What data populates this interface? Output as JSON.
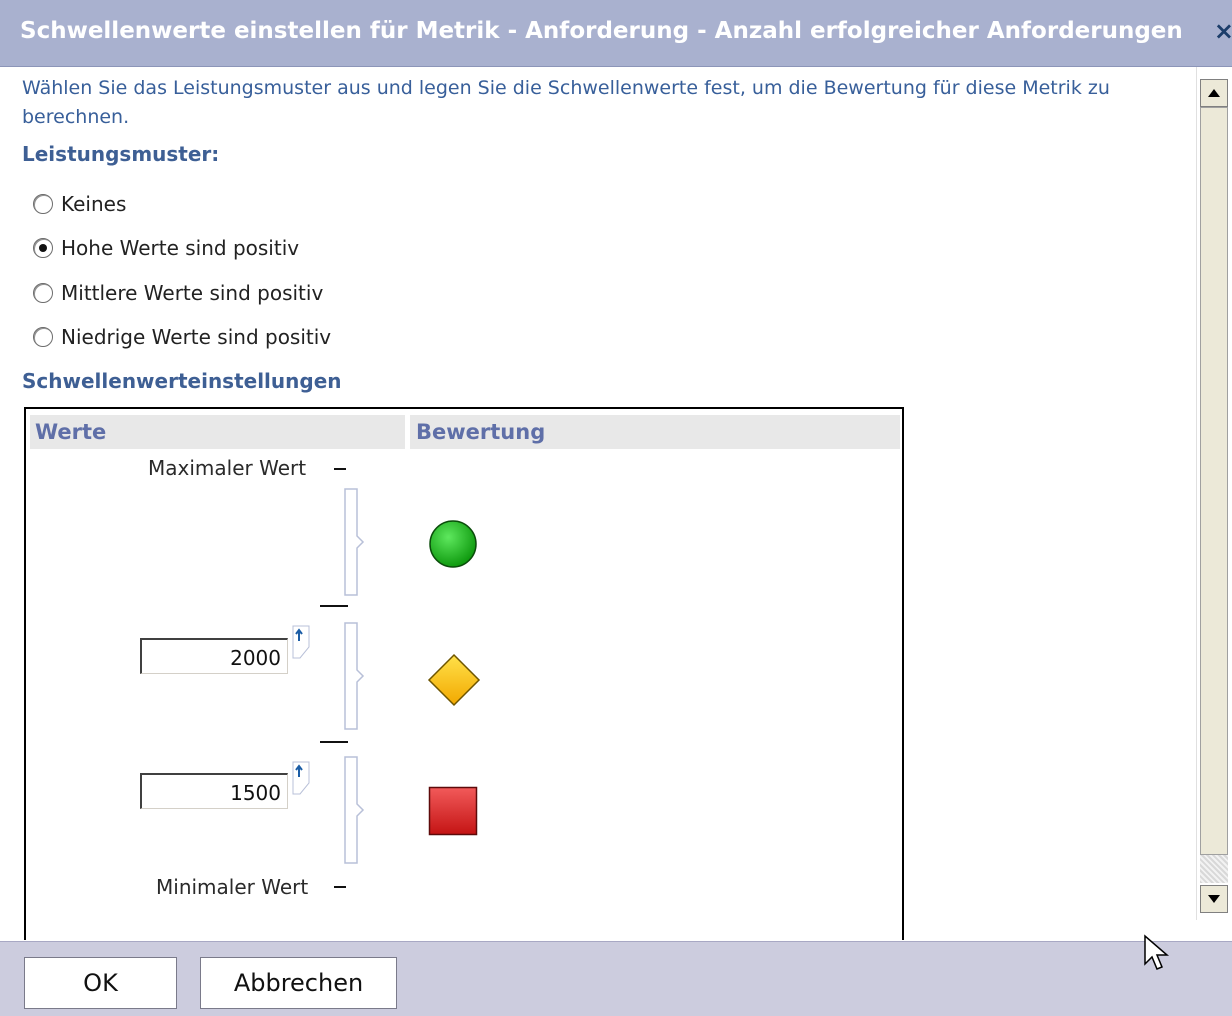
{
  "dialog": {
    "title": "Schwellenwerte einstellen für Metrik - Anforderung - Anzahl erfolgreicher Anforderungen",
    "close_label": "×"
  },
  "intro_text": "Wählen Sie das Leistungsmuster aus und legen Sie die Schwellenwerte fest, um die Bewertung für diese Metrik zu berechnen.",
  "performance_pattern": {
    "heading": "Leistungsmuster:",
    "options": [
      {
        "label": "Keines",
        "selected": false
      },
      {
        "label": "Hohe Werte sind positiv",
        "selected": true
      },
      {
        "label": "Mittlere Werte sind positiv",
        "selected": false
      },
      {
        "label": "Niedrige Werte sind positiv",
        "selected": false
      }
    ]
  },
  "threshold_settings": {
    "heading": "Schwellenwerteinstellungen",
    "column_values": "Werte",
    "column_rating": "Bewertung",
    "max_label": "Maximaler Wert",
    "min_label": "Minimaler Wert",
    "upper_threshold": "2000",
    "lower_threshold": "1500",
    "ratings": [
      {
        "icon": "green-circle-icon",
        "color": "#22b422"
      },
      {
        "icon": "yellow-diamond-icon",
        "color": "#f6c200"
      },
      {
        "icon": "red-square-icon",
        "color": "#d42020"
      }
    ]
  },
  "buttons": {
    "ok": "OK",
    "cancel": "Abbrechen"
  },
  "colors": {
    "titlebar": "#a9b1cf",
    "footer": "#ccccde",
    "heading": "#3e5f94",
    "intro": "#385f9a"
  }
}
